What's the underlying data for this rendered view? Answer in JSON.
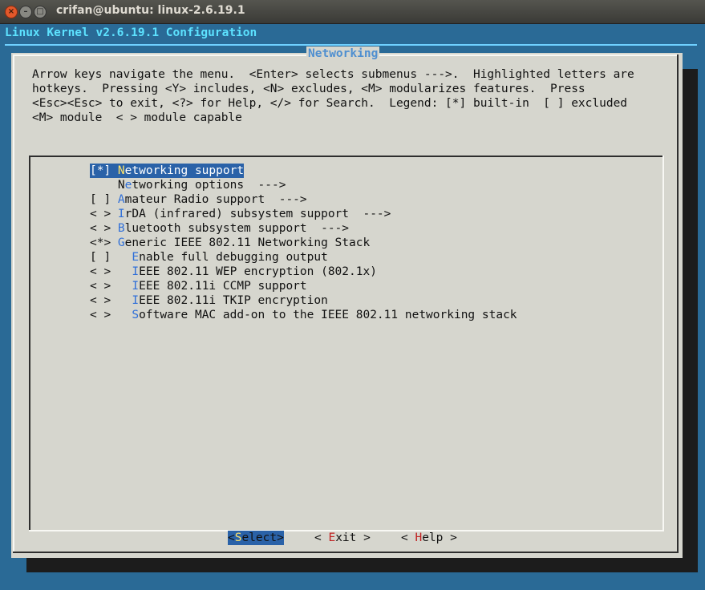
{
  "window": {
    "title": "crifan@ubuntu: linux-2.6.19.1"
  },
  "backtitle": "Linux Kernel v2.6.19.1 Configuration",
  "dialog": {
    "title": "Networking",
    "help_lines": [
      "Arrow keys navigate the menu.  <Enter> selects submenus --->.  Highlighted letters are",
      "hotkeys.  Pressing <Y> includes, <N> excludes, <M> modularizes features.  Press",
      "<Esc><Esc> to exit, <?> for Help, </> for Search.  Legend: [*] built-in  [ ] excluded",
      "<M> module  < > module capable"
    ],
    "menu_items": [
      {
        "prefix": "[*] ",
        "hotkey": "N",
        "rest": "etworking support",
        "selected": true
      },
      {
        "prefix": "    N",
        "hotkey": "e",
        "rest": "tworking options  --->",
        "selected": false
      },
      {
        "prefix": "[ ] ",
        "hotkey": "A",
        "rest": "mateur Radio support  --->",
        "selected": false
      },
      {
        "prefix": "< > ",
        "hotkey": "I",
        "rest": "rDA (infrared) subsystem support  --->",
        "selected": false
      },
      {
        "prefix": "< > ",
        "hotkey": "B",
        "rest": "luetooth subsystem support  --->",
        "selected": false
      },
      {
        "prefix": "<*> ",
        "hotkey": "G",
        "rest": "eneric IEEE 802.11 Networking Stack",
        "selected": false
      },
      {
        "prefix": "[ ]   ",
        "hotkey": "E",
        "rest": "nable full debugging output",
        "selected": false
      },
      {
        "prefix": "< >   ",
        "hotkey": "I",
        "rest": "EEE 802.11 WEP encryption (802.1x)",
        "selected": false
      },
      {
        "prefix": "< >   ",
        "hotkey": "I",
        "rest": "EEE 802.11i CCMP support",
        "selected": false
      },
      {
        "prefix": "< >   ",
        "hotkey": "I",
        "rest": "EEE 802.11i TKIP encryption",
        "selected": false
      },
      {
        "prefix": "< >   ",
        "hotkey": "S",
        "rest": "oftware MAC add-on to the IEEE 802.11 networking stack",
        "selected": false
      }
    ],
    "buttons": {
      "select": {
        "pre": "<",
        "hotkey": "S",
        "post": "elect>"
      },
      "exit": {
        "pre": "< ",
        "hotkey": "E",
        "post": "xit >"
      },
      "help": {
        "pre": "< ",
        "hotkey": "H",
        "post": "elp >"
      }
    }
  }
}
